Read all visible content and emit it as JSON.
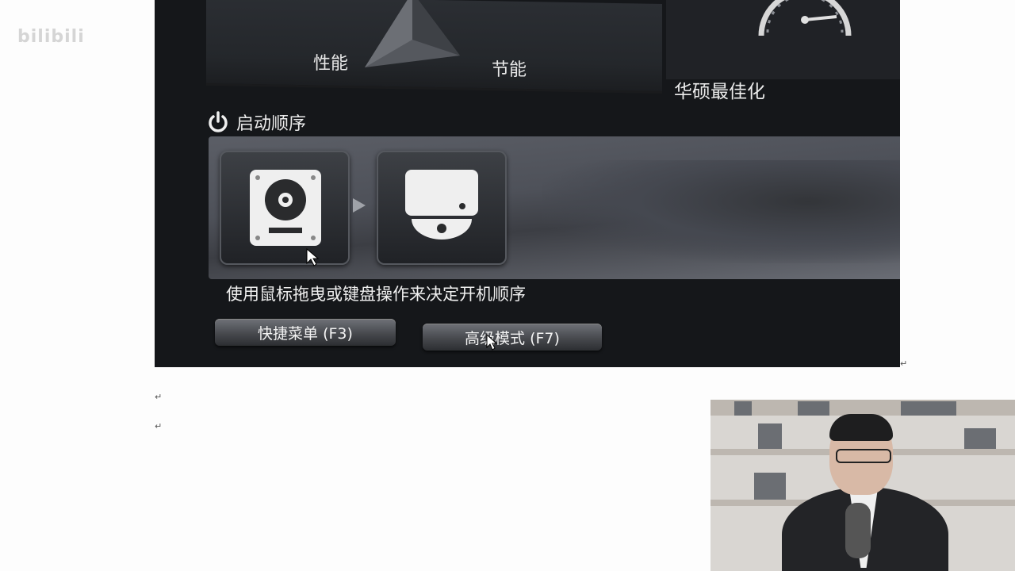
{
  "watermark": {
    "text": "bilibili"
  },
  "bios": {
    "mode_labels": {
      "performance": "性能",
      "energy_saving": "节能",
      "asus_optimal": "华硕最佳化"
    },
    "boot_priority": {
      "title": "启动顺序",
      "devices": [
        {
          "name": "hard-disk",
          "icon": "hdd-icon"
        },
        {
          "name": "optical-drive",
          "icon": "optical-drive-icon"
        }
      ],
      "hint": "使用鼠标拖曳或键盘操作来决定开机顺序"
    },
    "buttons": {
      "ez_menu": "快捷菜单 (F3)",
      "advanced_mode": "高级模式 (F7)"
    }
  },
  "colors": {
    "panel": "#15171a",
    "text": "#f0f0f0",
    "page": "#fdfdfd"
  }
}
